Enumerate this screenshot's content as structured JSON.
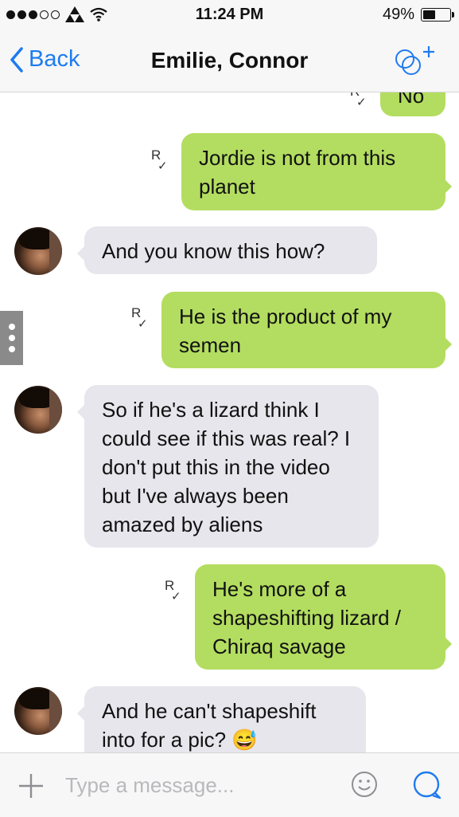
{
  "status_bar": {
    "time": "11:24 PM",
    "battery_percent": "49%",
    "battery_level": 0.49,
    "signal_bars_filled": 3,
    "signal_bars_total": 5
  },
  "nav": {
    "back_label": "Back",
    "title": "Emilie, Connor",
    "add_people_icon": "add-people-icon"
  },
  "messages": [
    {
      "direction": "out",
      "text": "No",
      "receipt": "R"
    },
    {
      "direction": "out",
      "text": "Jordie is not from this planet",
      "receipt": "R"
    },
    {
      "direction": "in",
      "text": "And you know this how?"
    },
    {
      "direction": "out",
      "text": "He is the product of my semen",
      "receipt": "R"
    },
    {
      "direction": "in",
      "text": "So if he's a lizard think I could see if this was real? I don't put this in the video but I've always been amazed by aliens"
    },
    {
      "direction": "out",
      "text": "He's more of a shapeshifting lizard / Chiraq savage",
      "receipt": "R"
    },
    {
      "direction": "in",
      "text": "And he can't shapeshift into for a pic?",
      "emoji": "😅"
    }
  ],
  "input": {
    "placeholder": "Type a message..."
  },
  "colors": {
    "accent": "#1e7bf0",
    "outgoing_bubble": "#b3dd60",
    "incoming_bubble": "#e6e6ec"
  }
}
